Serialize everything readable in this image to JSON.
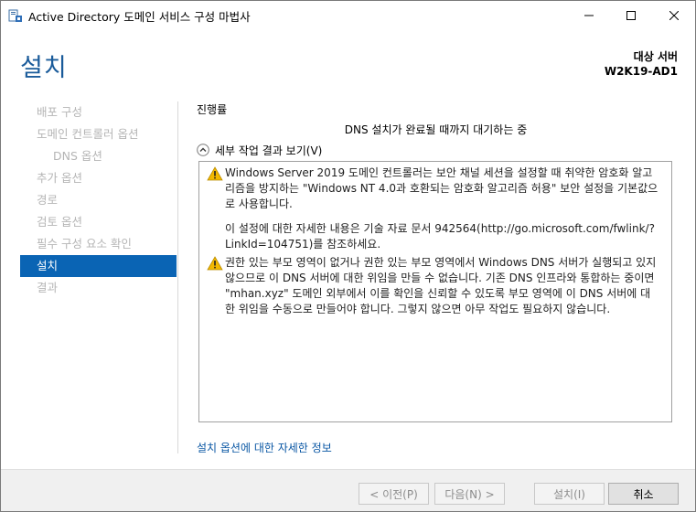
{
  "window": {
    "title": "Active Directory 도메인 서비스 구성 마법사",
    "icon": "ad-ds-wizard-icon"
  },
  "header": {
    "page_title": "설치",
    "target_label": "대상 서버",
    "target_server": "W2K19-AD1"
  },
  "sidebar": {
    "items": [
      {
        "label": "배포 구성",
        "state": "disabled"
      },
      {
        "label": "도메인 컨트롤러 옵션",
        "state": "disabled"
      },
      {
        "label": "DNS 옵션",
        "state": "disabled",
        "sub": true
      },
      {
        "label": "추가 옵션",
        "state": "disabled"
      },
      {
        "label": "경로",
        "state": "disabled"
      },
      {
        "label": "검토 옵션",
        "state": "disabled"
      },
      {
        "label": "필수 구성 요소 확인",
        "state": "disabled"
      },
      {
        "label": "설치",
        "state": "active"
      },
      {
        "label": "결과",
        "state": "disabled"
      }
    ]
  },
  "main": {
    "progress_label": "진행률",
    "progress_status": "DNS 설치가 완료될 때까지 대기하는 중",
    "expander_label": "세부 작업 결과 보기(V)",
    "messages": [
      {
        "icon": "warning-icon",
        "paragraphs": [
          "Windows Server 2019 도메인 컨트롤러는 보안 채널 세션을 설정할 때 취약한 암호화 알고리즘을 방지하는 \"Windows NT 4.0과 호환되는 암호화 알고리즘 허용\" 보안 설정을 기본값으로 사용합니다.",
          "이 설정에 대한 자세한 내용은 기술 자료 문서 942564(http://go.microsoft.com/fwlink/?LinkId=104751)를 참조하세요."
        ]
      },
      {
        "icon": "warning-icon",
        "paragraphs": [
          "권한 있는 부모 영역이 없거나 권한 있는 부모 영역에서 Windows DNS 서버가 실행되고 있지 않으므로 이 DNS 서버에 대한 위임을 만들 수 없습니다. 기존 DNS 인프라와 통합하는 중이면 \"mhan.xyz\" 도메인 외부에서 이를 확인을 신뢰할 수 있도록 부모 영역에 이 DNS 서버에 대한 위임을 수동으로 만들어야 합니다. 그렇지 않으면 아무 작업도 필요하지 않습니다."
        ]
      }
    ],
    "more_info_link": "설치 옵션에 대한 자세한 정보"
  },
  "footer": {
    "prev_label": "< 이전(P)",
    "next_label": "다음(N) >",
    "install_label": "설치(I)",
    "cancel_label": "취소"
  },
  "colors": {
    "accent": "#0a64b4",
    "title_blue": "#1a5b9a",
    "link": "#0a57a4",
    "warning": "#f2b800"
  }
}
